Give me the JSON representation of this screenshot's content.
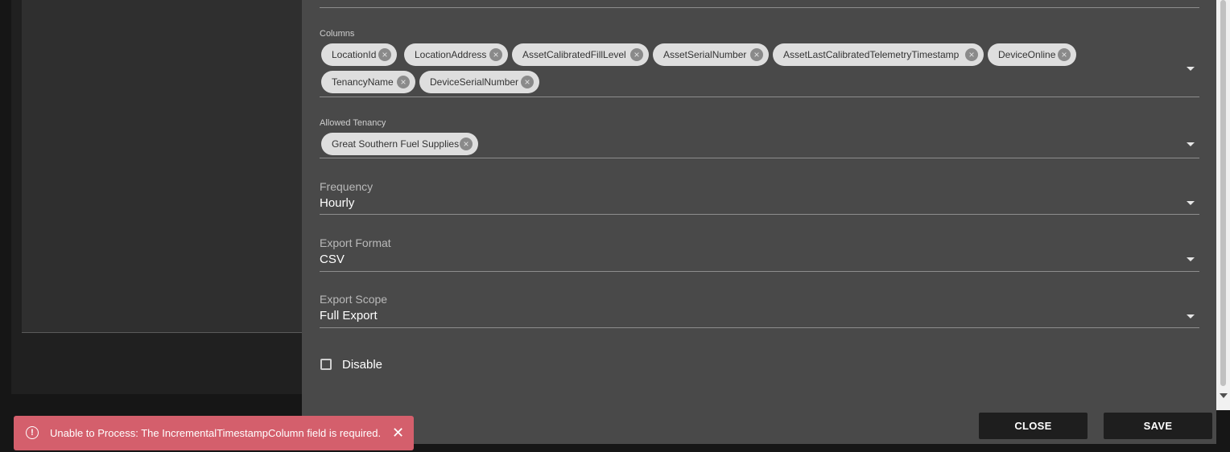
{
  "columns_field": {
    "label": "Columns",
    "chips": [
      {
        "label": "LocationId"
      },
      {
        "label": "LocationAddress"
      },
      {
        "label": "AssetCalibratedFillLevel"
      },
      {
        "label": "AssetSerialNumber"
      },
      {
        "label": "AssetLastCalibratedTelemetryTimestamp"
      },
      {
        "label": "DeviceOnline"
      },
      {
        "label": "TenancyName"
      },
      {
        "label": "DeviceSerialNumber"
      }
    ]
  },
  "tenancy_field": {
    "label": "Allowed Tenancy",
    "chips": [
      {
        "label": "Great Southern Fuel Supplies"
      }
    ]
  },
  "frequency": {
    "label": "Frequency",
    "value": "Hourly"
  },
  "export_format": {
    "label": "Export Format",
    "value": "CSV"
  },
  "export_scope": {
    "label": "Export Scope",
    "value": "Full Export"
  },
  "disable": {
    "label": "Disable",
    "checked": false
  },
  "actions": {
    "close": "CLOSE",
    "save": "SAVE"
  },
  "toast": {
    "message": "Unable to Process: The IncrementalTimestampColumn field is required."
  },
  "icons": {
    "chip_remove": "cancel-circle-icon",
    "dropdown": "arrow-drop-down-icon",
    "toast_status": "error-outline-icon",
    "toast_close": "close-icon"
  }
}
